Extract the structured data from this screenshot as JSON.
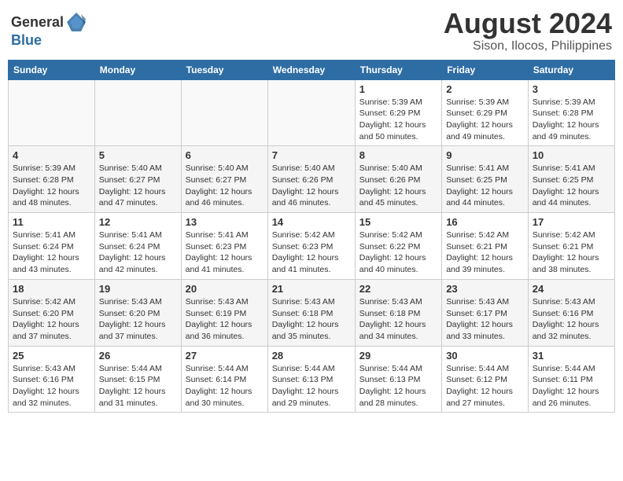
{
  "header": {
    "logo_general": "General",
    "logo_blue": "Blue",
    "title": "August 2024",
    "subtitle": "Sison, Ilocos, Philippines"
  },
  "days_of_week": [
    "Sunday",
    "Monday",
    "Tuesday",
    "Wednesday",
    "Thursday",
    "Friday",
    "Saturday"
  ],
  "weeks": [
    [
      {
        "day": "",
        "info": ""
      },
      {
        "day": "",
        "info": ""
      },
      {
        "day": "",
        "info": ""
      },
      {
        "day": "",
        "info": ""
      },
      {
        "day": "1",
        "info": "Sunrise: 5:39 AM\nSunset: 6:29 PM\nDaylight: 12 hours\nand 50 minutes."
      },
      {
        "day": "2",
        "info": "Sunrise: 5:39 AM\nSunset: 6:29 PM\nDaylight: 12 hours\nand 49 minutes."
      },
      {
        "day": "3",
        "info": "Sunrise: 5:39 AM\nSunset: 6:28 PM\nDaylight: 12 hours\nand 49 minutes."
      }
    ],
    [
      {
        "day": "4",
        "info": "Sunrise: 5:39 AM\nSunset: 6:28 PM\nDaylight: 12 hours\nand 48 minutes."
      },
      {
        "day": "5",
        "info": "Sunrise: 5:40 AM\nSunset: 6:27 PM\nDaylight: 12 hours\nand 47 minutes."
      },
      {
        "day": "6",
        "info": "Sunrise: 5:40 AM\nSunset: 6:27 PM\nDaylight: 12 hours\nand 46 minutes."
      },
      {
        "day": "7",
        "info": "Sunrise: 5:40 AM\nSunset: 6:26 PM\nDaylight: 12 hours\nand 46 minutes."
      },
      {
        "day": "8",
        "info": "Sunrise: 5:40 AM\nSunset: 6:26 PM\nDaylight: 12 hours\nand 45 minutes."
      },
      {
        "day": "9",
        "info": "Sunrise: 5:41 AM\nSunset: 6:25 PM\nDaylight: 12 hours\nand 44 minutes."
      },
      {
        "day": "10",
        "info": "Sunrise: 5:41 AM\nSunset: 6:25 PM\nDaylight: 12 hours\nand 44 minutes."
      }
    ],
    [
      {
        "day": "11",
        "info": "Sunrise: 5:41 AM\nSunset: 6:24 PM\nDaylight: 12 hours\nand 43 minutes."
      },
      {
        "day": "12",
        "info": "Sunrise: 5:41 AM\nSunset: 6:24 PM\nDaylight: 12 hours\nand 42 minutes."
      },
      {
        "day": "13",
        "info": "Sunrise: 5:41 AM\nSunset: 6:23 PM\nDaylight: 12 hours\nand 41 minutes."
      },
      {
        "day": "14",
        "info": "Sunrise: 5:42 AM\nSunset: 6:23 PM\nDaylight: 12 hours\nand 41 minutes."
      },
      {
        "day": "15",
        "info": "Sunrise: 5:42 AM\nSunset: 6:22 PM\nDaylight: 12 hours\nand 40 minutes."
      },
      {
        "day": "16",
        "info": "Sunrise: 5:42 AM\nSunset: 6:21 PM\nDaylight: 12 hours\nand 39 minutes."
      },
      {
        "day": "17",
        "info": "Sunrise: 5:42 AM\nSunset: 6:21 PM\nDaylight: 12 hours\nand 38 minutes."
      }
    ],
    [
      {
        "day": "18",
        "info": "Sunrise: 5:42 AM\nSunset: 6:20 PM\nDaylight: 12 hours\nand 37 minutes."
      },
      {
        "day": "19",
        "info": "Sunrise: 5:43 AM\nSunset: 6:20 PM\nDaylight: 12 hours\nand 37 minutes."
      },
      {
        "day": "20",
        "info": "Sunrise: 5:43 AM\nSunset: 6:19 PM\nDaylight: 12 hours\nand 36 minutes."
      },
      {
        "day": "21",
        "info": "Sunrise: 5:43 AM\nSunset: 6:18 PM\nDaylight: 12 hours\nand 35 minutes."
      },
      {
        "day": "22",
        "info": "Sunrise: 5:43 AM\nSunset: 6:18 PM\nDaylight: 12 hours\nand 34 minutes."
      },
      {
        "day": "23",
        "info": "Sunrise: 5:43 AM\nSunset: 6:17 PM\nDaylight: 12 hours\nand 33 minutes."
      },
      {
        "day": "24",
        "info": "Sunrise: 5:43 AM\nSunset: 6:16 PM\nDaylight: 12 hours\nand 32 minutes."
      }
    ],
    [
      {
        "day": "25",
        "info": "Sunrise: 5:43 AM\nSunset: 6:16 PM\nDaylight: 12 hours\nand 32 minutes."
      },
      {
        "day": "26",
        "info": "Sunrise: 5:44 AM\nSunset: 6:15 PM\nDaylight: 12 hours\nand 31 minutes."
      },
      {
        "day": "27",
        "info": "Sunrise: 5:44 AM\nSunset: 6:14 PM\nDaylight: 12 hours\nand 30 minutes."
      },
      {
        "day": "28",
        "info": "Sunrise: 5:44 AM\nSunset: 6:13 PM\nDaylight: 12 hours\nand 29 minutes."
      },
      {
        "day": "29",
        "info": "Sunrise: 5:44 AM\nSunset: 6:13 PM\nDaylight: 12 hours\nand 28 minutes."
      },
      {
        "day": "30",
        "info": "Sunrise: 5:44 AM\nSunset: 6:12 PM\nDaylight: 12 hours\nand 27 minutes."
      },
      {
        "day": "31",
        "info": "Sunrise: 5:44 AM\nSunset: 6:11 PM\nDaylight: 12 hours\nand 26 minutes."
      }
    ]
  ]
}
